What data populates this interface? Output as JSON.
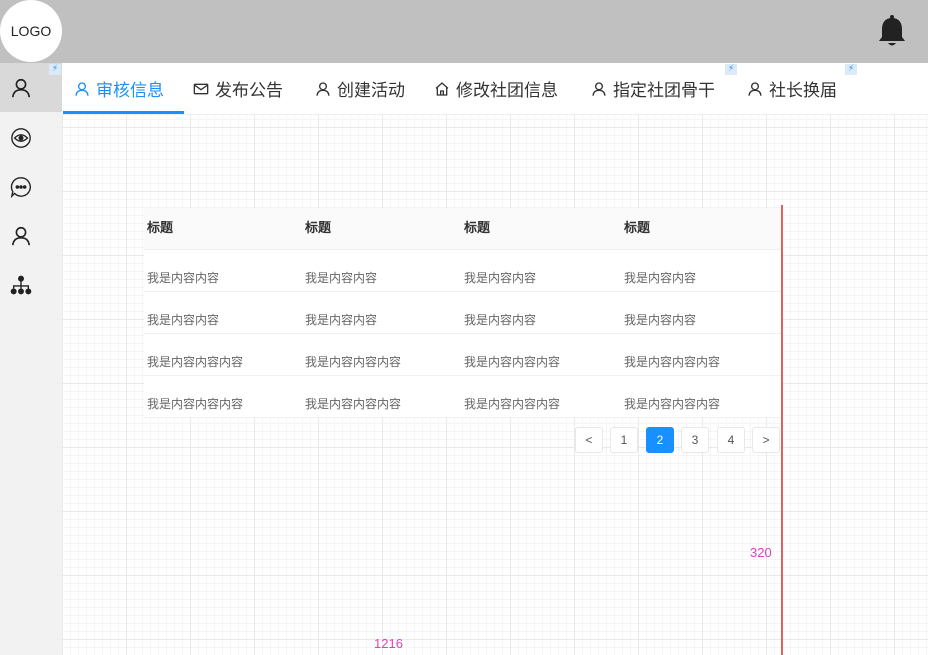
{
  "header": {
    "logo": "LOGO",
    "bell_icon": "bell-icon"
  },
  "sidebar": {
    "items": [
      {
        "icon": "user-icon",
        "active": true
      },
      {
        "icon": "eye-icon"
      },
      {
        "icon": "chat-bubble-icon"
      },
      {
        "icon": "user-icon"
      },
      {
        "icon": "org-tree-icon"
      }
    ]
  },
  "tabs": [
    {
      "label": "审核信息",
      "icon": "user-icon"
    },
    {
      "label": "发布公告",
      "icon": "mail-icon"
    },
    {
      "label": "创建活动",
      "icon": "user-icon"
    },
    {
      "label": "修改社团信息",
      "icon": "home-icon"
    },
    {
      "label": "指定社团骨干",
      "icon": "user-icon"
    },
    {
      "label": "社长换届",
      "icon": "user-icon"
    }
  ],
  "table": {
    "headers": [
      "标题",
      "标题",
      "标题",
      "标题"
    ],
    "rows": [
      [
        "我是内容内容",
        "我是内容内容",
        "我是内容内容",
        "我是内容内容"
      ],
      [
        "我是内容内容",
        "我是内容内容",
        "我是内容内容",
        "我是内容内容"
      ],
      [
        "我是内容内容内容",
        "我是内容内容内容",
        "我是内容内容内容",
        "我是内容内容内容"
      ],
      [
        "我是内容内容内容",
        "我是内容内容内容",
        "我是内容内容内容",
        "我是内容内容内容"
      ]
    ]
  },
  "pagination": {
    "prev": "<",
    "pages": [
      "1",
      "2",
      "3",
      "4"
    ],
    "current": "2",
    "next": ">"
  },
  "annotations": {
    "height_label": "320",
    "width_label": "1216"
  },
  "colors": {
    "accent": "#1890ff",
    "header_bg": "#c0c0c0",
    "measure_line": "#e06060",
    "measure_text": "#e040c0"
  }
}
